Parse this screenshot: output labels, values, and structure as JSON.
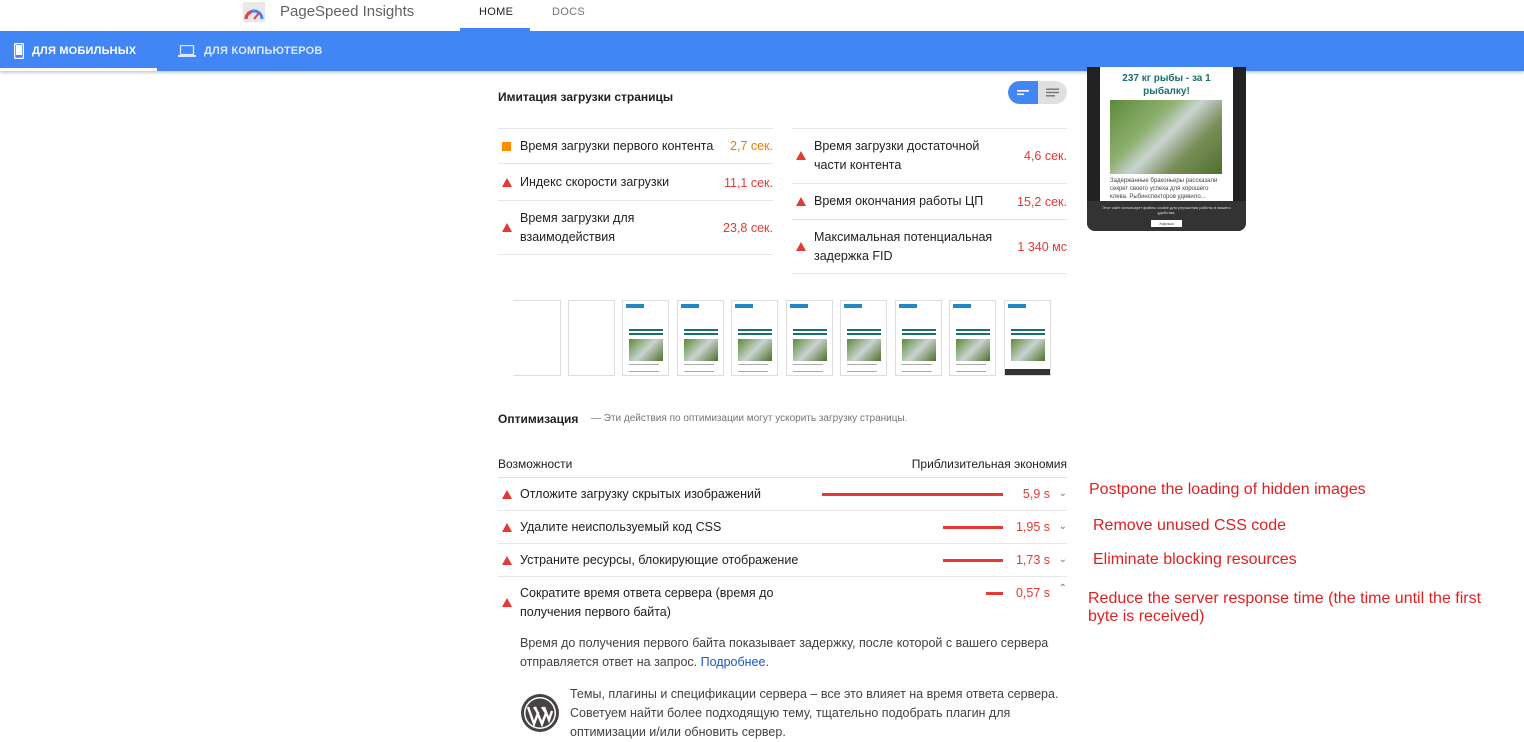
{
  "app": {
    "brand": "PageSpeed Insights"
  },
  "nav": {
    "home": "HOME",
    "docs": "DOCS"
  },
  "device_tabs": {
    "mobile": "ДЛЯ МОБИЛЬНЫХ",
    "desktop": "ДЛЯ КОМПЬЮТЕРОВ"
  },
  "lab": {
    "title": "Имитация загрузки страницы",
    "left": [
      {
        "label": "Время загрузки первого контента",
        "value": "2,7 сек.",
        "status": "average"
      },
      {
        "label": "Индекс скорости загрузки",
        "value": "11,1 сек.",
        "status": "fail"
      },
      {
        "label": "Время загрузки для взаимодействия",
        "value": "23,8 сек.",
        "status": "fail"
      }
    ],
    "right": [
      {
        "label": "Время загрузки достаточной части контента",
        "value": "4,6 сек.",
        "status": "fail"
      },
      {
        "label": "Время окончания работы ЦП",
        "value": "15,2 сек.",
        "status": "fail"
      },
      {
        "label": "Максимальная потенциальная задержка FID",
        "value": "1 340 мс",
        "status": "fail"
      }
    ]
  },
  "preview": {
    "title": "237 кг рыбы - за 1 рыбалку!",
    "text": "Задержанные браконьеры рассказали секрет своего успеха для хорошего клева. Рыбинспекторов удивило...",
    "cookie_text": "Этот сайт использует файлы cookie для улучшения работы и вашего удобства.",
    "cookie_button": "Хорошо"
  },
  "optimization": {
    "title": "Оптимизация",
    "subtitle": "— Эти действия по оптимизации могут ускорить загрузку страницы.",
    "col_opportunity": "Возможности",
    "col_savings": "Приблизительная экономия",
    "items": [
      {
        "label": "Отложите загрузку скрытых изображений",
        "savings": "5,9 s",
        "savings_value": 5.9,
        "expanded": false
      },
      {
        "label": "Удалите неиспользуемый код CSS",
        "savings": "1,95 s",
        "savings_value": 1.95,
        "expanded": false
      },
      {
        "label": "Устраните ресурсы, блокирующие отображение",
        "savings": "1,73 s",
        "savings_value": 1.73,
        "expanded": false
      },
      {
        "label": "Сократите время ответа сервера (время до получения первого байта)",
        "savings": "0,57 s",
        "savings_value": 0.57,
        "expanded": true
      }
    ],
    "detail_text": "Время до получения первого байта показывает задержку, после которой с вашего сервера отправляется ответ на запрос.",
    "detail_link": "Подробнее",
    "wp_text": "Темы, плагины и спецификации сервера – все это влияет на время ответа сервера. Советуем найти более подходящую тему, тщательно подобрать плагин для оптимизации и/или обновить сервер."
  },
  "annotations": [
    "Postpone the loading of hidden images",
    "Remove unused CSS code",
    "Eliminate blocking resources",
    "Reduce the server response time (the time until the first byte is received)"
  ],
  "colors": {
    "accent": "#4285f4",
    "fail": "#e53935",
    "average": "#fb8c00",
    "annotation": "#e02020"
  }
}
